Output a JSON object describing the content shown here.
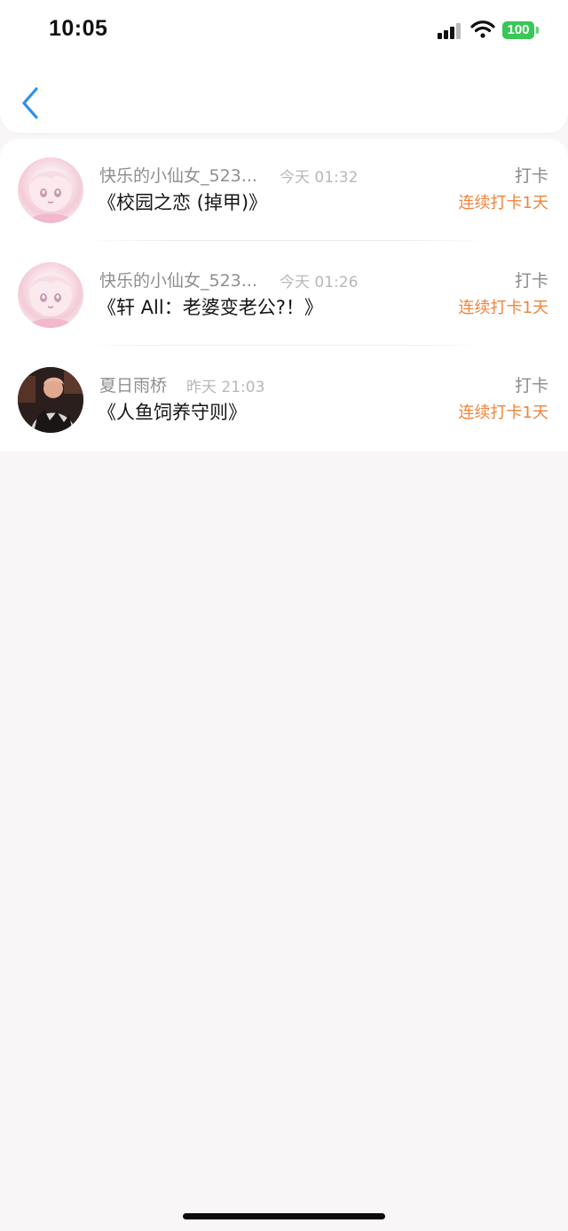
{
  "status_bar": {
    "time": "10:05",
    "battery": "100"
  },
  "colors": {
    "accent_back": "#2f8ef0",
    "streak": "#f0843b",
    "battery": "#39c759"
  },
  "nav": {
    "back_icon": "chevron-left-icon"
  },
  "checkins": [
    {
      "user": "快乐的小仙女_523...",
      "time": "今天 01:32",
      "book": "《校园之恋 (掉甲)》",
      "action": "打卡",
      "streak": "连续打卡1天",
      "avatar": "anime-girl-avatar"
    },
    {
      "user": "快乐的小仙女_523...",
      "time": "今天 01:26",
      "book": "《轩 All：老婆变老公?！》",
      "action": "打卡",
      "streak": "连续打卡1天",
      "avatar": "anime-girl-avatar"
    },
    {
      "user": "夏日雨桥",
      "time": "昨天 21:03",
      "book": "《人鱼饲养守则》",
      "action": "打卡",
      "streak": "连续打卡1天",
      "avatar": "photo-avatar"
    }
  ]
}
